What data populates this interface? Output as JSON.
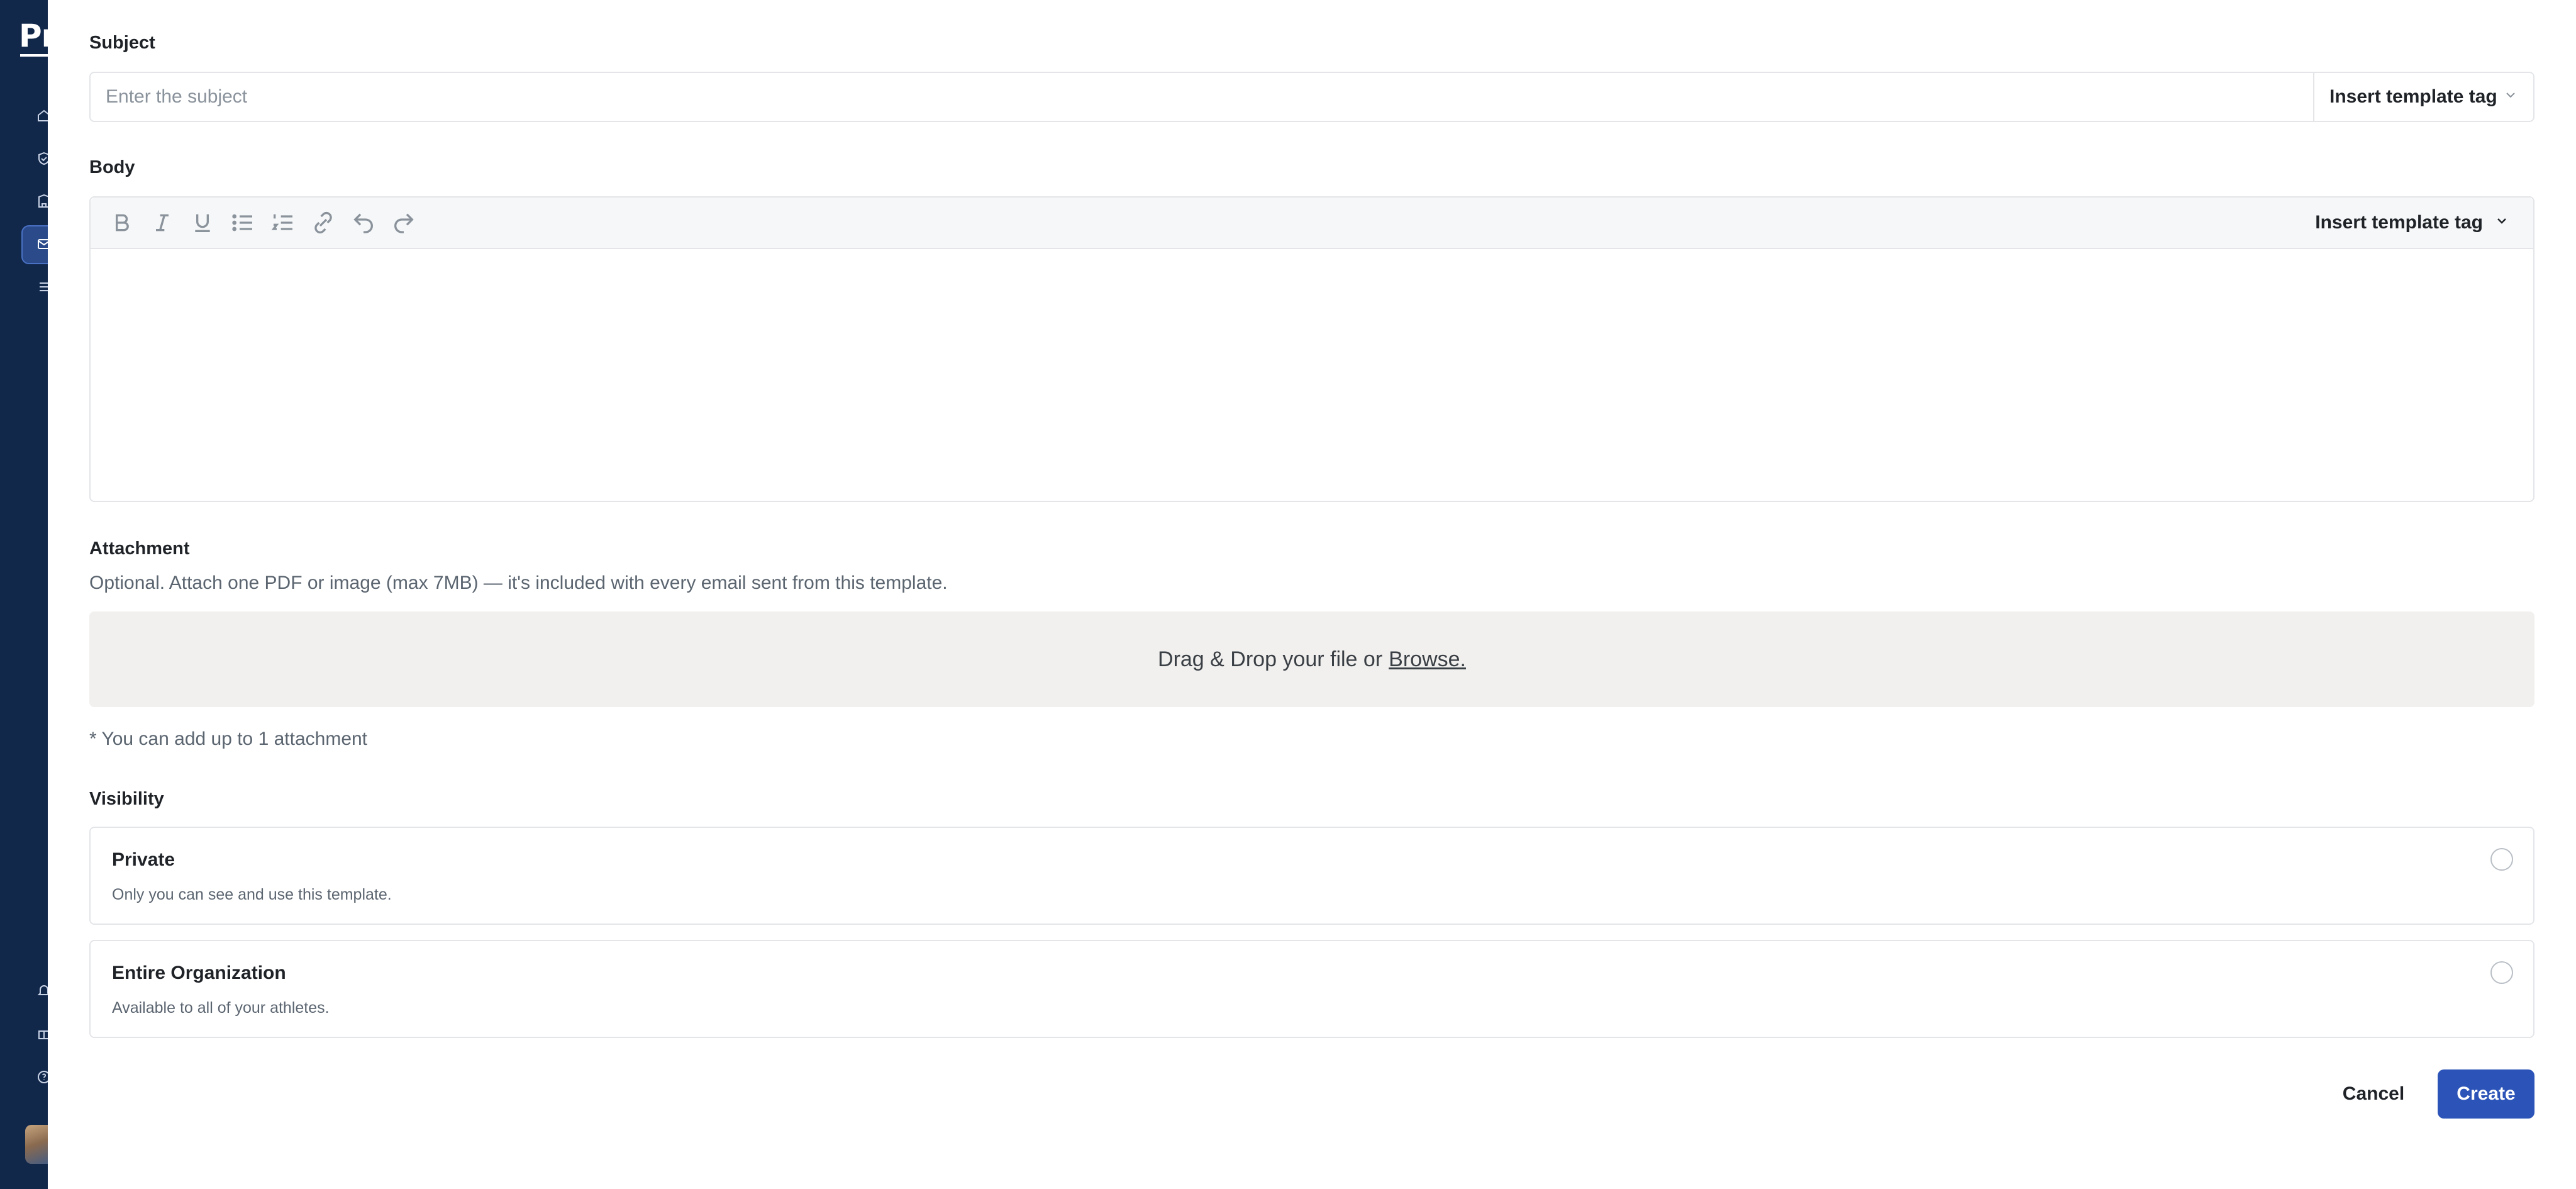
{
  "app": {
    "brand_text": "Pr"
  },
  "colors": {
    "sidebar_bg": "#12284b",
    "primary_button": "#2c54b8",
    "dropzone_bg": "#f1f0ee",
    "border": "#e3e5e8"
  },
  "sidebar": {
    "icons": [
      "home-icon",
      "shield-check-icon",
      "building-icon",
      "mail-icon",
      "list-icon",
      "bell-icon",
      "gift-icon",
      "help-icon"
    ],
    "active_item": "mail-icon"
  },
  "subject": {
    "label": "Subject",
    "placeholder": "Enter the subject",
    "value": "",
    "tag_button_label": "Insert template tag"
  },
  "body": {
    "label": "Body",
    "toolbar": {
      "tools": [
        "bold-icon",
        "italic-icon",
        "underline-icon",
        "bullet-list-icon",
        "numbered-list-icon",
        "link-icon",
        "undo-icon",
        "redo-icon"
      ],
      "tag_button_label": "Insert template tag"
    },
    "value": ""
  },
  "attachment": {
    "label": "Attachment",
    "help": "Optional. Attach one PDF or image (max 7MB) — it's included with every email sent from this template.",
    "dropzone_text": "Drag & Drop your file or",
    "browse_label": "Browse.",
    "limit_note": "* You can add up to 1 attachment"
  },
  "visibility": {
    "label": "Visibility",
    "options": [
      {
        "title": "Private",
        "description": "Only you can see and use this template.",
        "selected": false
      },
      {
        "title": "Entire Organization",
        "description": "Available to all of your athletes.",
        "selected": false
      }
    ]
  },
  "footer": {
    "cancel_label": "Cancel",
    "create_label": "Create"
  }
}
